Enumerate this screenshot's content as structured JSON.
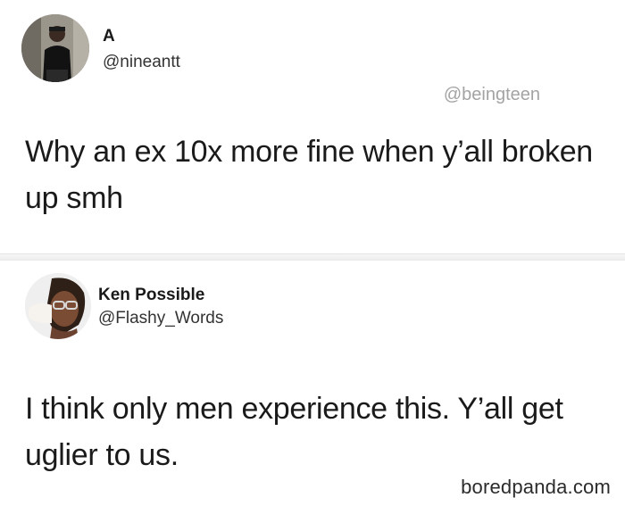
{
  "tweet1": {
    "display_name": "A",
    "handle": "@nineantt",
    "credit": "@beingteen",
    "text": "Why an ex 10x more fine when y’all broken up smh"
  },
  "tweet2": {
    "display_name": "Ken Possible",
    "handle": "@Flashy_Words",
    "text": "I think only men experience this. Y’all get uglier to us."
  },
  "watermark": "boredpanda.com"
}
